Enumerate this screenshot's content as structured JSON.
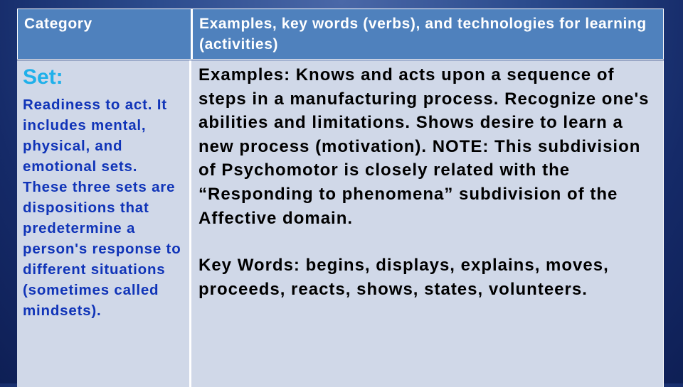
{
  "table": {
    "header": {
      "category": "Category",
      "examples": "Examples, key words (verbs), and technologies for learning (activities)"
    },
    "row": {
      "category_title": "Set:",
      "category_description": "Readiness to act. It includes mental, physical, and emotional sets. These three sets are dispositions that predetermine a person's response to different situations (sometimes called mindsets).",
      "examples": "Examples:  Knows and acts upon a sequence of steps in a manufacturing process. Recognize one's abilities and limitations. Shows desire to learn a new process (motivation). NOTE: This subdivision of Psychomotor is closely related with the “Responding to phenomena” subdivision of the Affective domain.",
      "key_words": "Key Words: begins, displays, explains, moves, proceeds, reacts, shows, states, volunteers."
    }
  }
}
